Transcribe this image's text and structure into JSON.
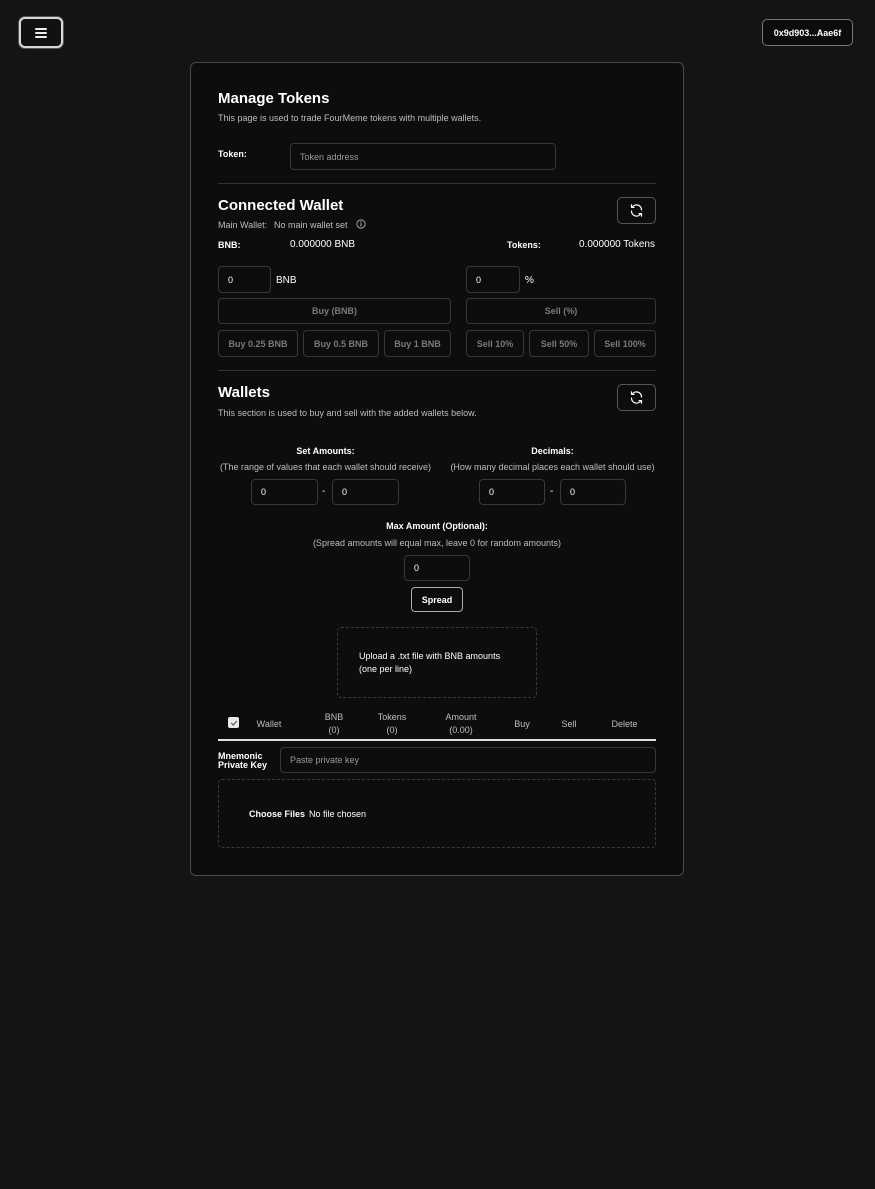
{
  "header": {
    "wallet_address": "0x9d903...Aae6f"
  },
  "manage": {
    "title": "Manage Tokens",
    "subtitle": "This page is used to trade FourMeme tokens with multiple wallets.",
    "token_label": "Token:",
    "token_placeholder": "Token address"
  },
  "connected": {
    "title": "Connected Wallet",
    "main_wallet_label": "Main Wallet:",
    "main_wallet_value": "No main wallet set",
    "bnb_label": "BNB:",
    "bnb_value": "0.000000 BNB",
    "tokens_label": "Tokens:",
    "tokens_value": "0.000000 Tokens",
    "buy_amount": "0",
    "buy_unit": "BNB",
    "sell_amount": "0",
    "sell_unit": "%",
    "buy_button": "Buy (BNB)",
    "sell_button": "Sell (%)",
    "quick_buys": [
      "Buy 0.25 BNB",
      "Buy 0.5 BNB",
      "Buy 1 BNB"
    ],
    "quick_sells": [
      "Sell 10%",
      "Sell 50%",
      "Sell 100%"
    ]
  },
  "wallets": {
    "title": "Wallets",
    "subtitle": "This section is used to buy and sell with the added wallets below.",
    "set_amounts_label": "Set Amounts:",
    "set_amounts_help": "(The range of values that each wallet should receive)",
    "amount_min": "0",
    "amount_max": "0",
    "range_sep": "-",
    "decimals_label": "Decimals:",
    "decimals_help": "(How many decimal places each wallet should use)",
    "decimals_min": "0",
    "decimals_max": "0",
    "max_amount_label": "Max Amount (Optional):",
    "max_amount_help": "(Spread amounts will equal max, leave 0 for random amounts)",
    "max_amount_value": "0",
    "spread_button": "Spread",
    "upload_text_line1": "Upload a .txt file with BNB amounts",
    "upload_text_line2": "(one per line)"
  },
  "table": {
    "checkbox_checked": true,
    "columns": {
      "wallet": "Wallet",
      "bnb": "BNB",
      "bnb_total": "(0)",
      "tokens": "Tokens",
      "tokens_total": "(0)",
      "amount": "Amount",
      "amount_total": "(0.00)",
      "buy": "Buy",
      "sell": "Sell",
      "delete": "Delete"
    },
    "mnemonic_label_line1": "Mnemonic",
    "mnemonic_label_line2": "Private Key",
    "private_key_placeholder": "Paste private key",
    "choose_files_button": "Choose Files",
    "no_file_text": "No file chosen"
  },
  "colors": {
    "background": "#141414",
    "card": "#0e0d0d",
    "border": "#4a4a4a",
    "text": "#ffffff",
    "muted": "#bdbdbd",
    "disabled": "#7a7a7a"
  }
}
